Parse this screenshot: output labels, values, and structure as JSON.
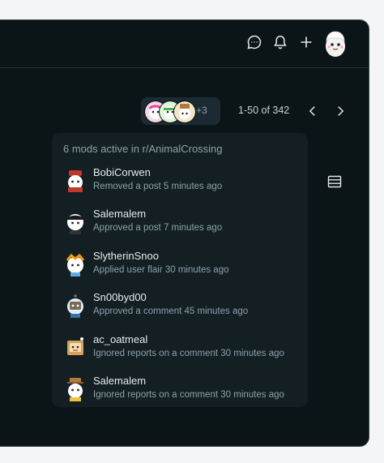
{
  "topbar": {
    "icons": [
      "chat-icon",
      "bell-icon",
      "plus-icon"
    ],
    "avatar": "user-avatar"
  },
  "controls": {
    "more_count": "+3",
    "pager": "1-50 of 342"
  },
  "popover": {
    "title": "6 mods active in r/AnimalCrossing",
    "mods": [
      {
        "name": "BobiCorwen",
        "action": "Removed a post 5 minutes ago",
        "color": "#c0392b"
      },
      {
        "name": "Salemalem",
        "action": "Approved a post 7 minutes ago",
        "color": "#f0f0f0"
      },
      {
        "name": "SlytherinSnoo",
        "action": "Applied user flair 30 minutes ago",
        "color": "#5dade2"
      },
      {
        "name": "Sn00byd00",
        "action": "Approved a comment 45 minutes ago",
        "color": "#7d6b4f"
      },
      {
        "name": "ac_oatmeal",
        "action": "Ignored reports on a comment 30 minutes ago",
        "color": "#d4a25a"
      },
      {
        "name": "Salemalem",
        "action": "Ignored reports on a comment 30 minutes ago",
        "color": "#b07a3c"
      }
    ]
  },
  "colors": {
    "background": "#0b1416",
    "popover": "#131f23",
    "text_primary": "#e6eaeb",
    "text_secondary": "#8ba2ad"
  }
}
